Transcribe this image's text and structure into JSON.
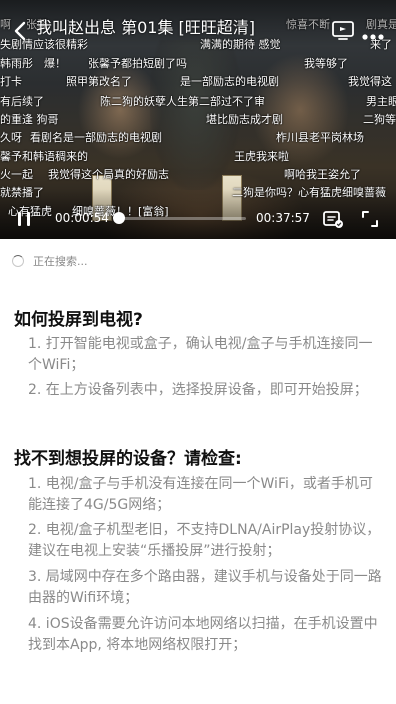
{
  "player": {
    "title": "我叫赵出息 第01集 [旺旺超清]",
    "time_current": "00:00:54",
    "time_total": "00:37:57",
    "progress": 0.024,
    "danmaku": [
      "啊",
      "张馨",
      "我叫赵出息",
      "惊喜不断",
      "剧真是",
      "失剧情应该很精彩",
      "满满的期待 感觉",
      "来了",
      "韩雨彤",
      "爆！",
      "张馨予都拍短剧了吗",
      "我等够了",
      "打卡",
      "照甲第改名了",
      "是一部励志的电视剧",
      "我觉得这",
      "有后续了",
      "陈二狗的妖孽人生第二部过不了审",
      "男主眼",
      "的重逢 狗哥",
      "堪比励志成才剧",
      "二狗等",
      "久呀",
      "看剧名是一部励志的电视剧",
      "柞川县老平岗林场",
      "馨予和韩语稠来的",
      "王虎我来啦",
      "火一起",
      "我觉得这个局真的好励志",
      "啊哈我王姿允了",
      "就禁播了",
      "二狗是你吗？心有猛虎细嗅蔷薇",
      "心有猛虎",
      "细嗅蔷薇！！[富翁]"
    ]
  },
  "search": {
    "status": "正在搜索..."
  },
  "help": {
    "section1": {
      "title": "如何投屏到电视?",
      "items": [
        "1. 打开智能电视或盒子，确认电视/盒子与手机连接同一个WiFi；",
        "2. 在上方设备列表中，选择投屏设备，即可开始投屏；"
      ]
    },
    "section2": {
      "title": "找不到想投屏的设备？请检查:",
      "items": [
        "1. 电视/盒子与手机没有连接在同一个WiFi，或者手机可能连接了4G/5G网络；",
        "2. 电视/盒子机型老旧，不支持DLNA/AirPlay投射协议，建议在电视上安装“乐播投屏”进行投射；",
        "3. 局域网中存在多个路由器，建议手机与设备处于同一路由器的Wifi环境；",
        "4. iOS设备需要允许访问本地网络以扫描，在手机设置中找到本App, 将本地网络权限打开；"
      ]
    }
  },
  "icons": {
    "back": "chevron-left-icon",
    "cast": "cast-icon",
    "more": "more-icon",
    "play": "play-icon",
    "danmaku": "danmaku-toggle-icon",
    "fullscreen": "fullscreen-icon"
  }
}
